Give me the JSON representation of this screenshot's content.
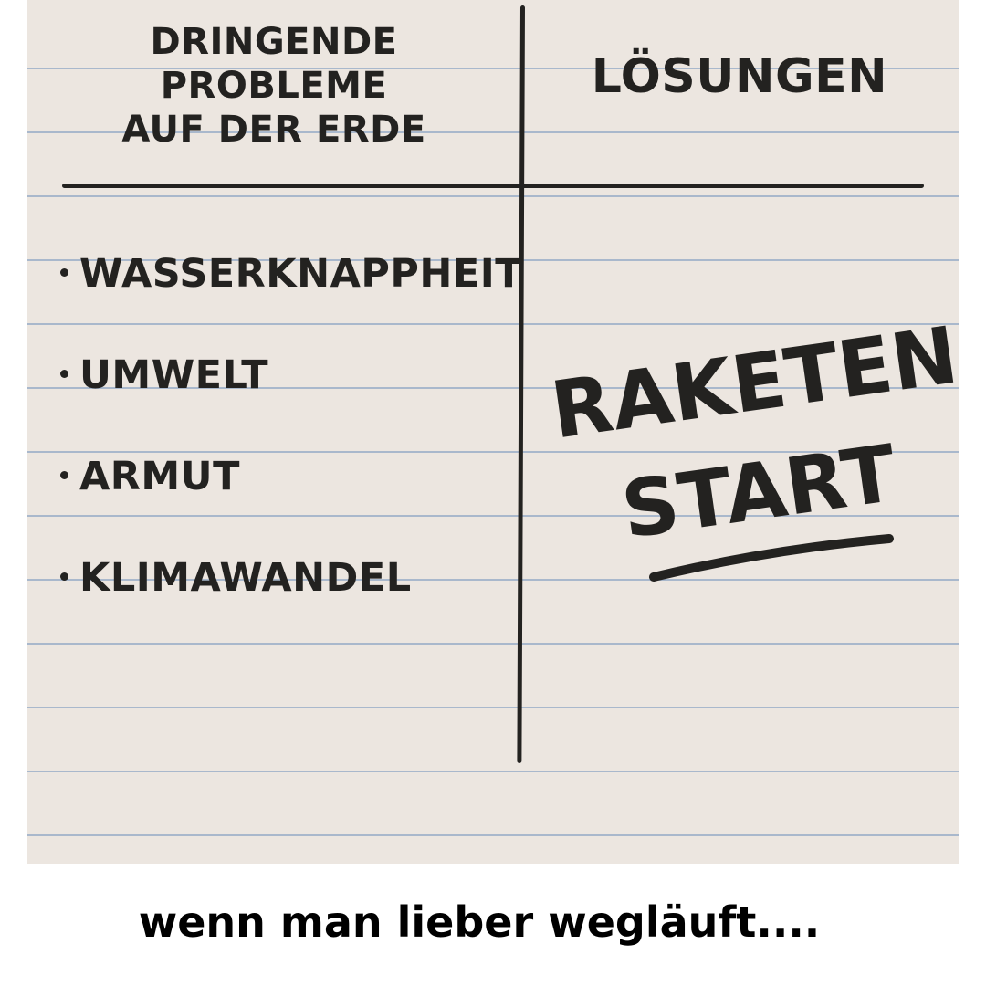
{
  "table": {
    "header_left_lines": [
      "DRINGENDE",
      "PROBLEME",
      "AUF DER ERDE"
    ],
    "header_right": "LÖSUNGEN",
    "problems": [
      "WASSERKNAPPHEIT",
      "UMWELT",
      "ARMUT",
      "KLIMAWANDEL"
    ],
    "solution_lines": [
      "RAKETEN-",
      "START"
    ]
  },
  "caption": "wenn man lieber wegläuft....",
  "colors": {
    "paper": "#ece6e0",
    "rule_lines": "#a9b8cc",
    "ink": "#232220",
    "caption": "#000000"
  }
}
